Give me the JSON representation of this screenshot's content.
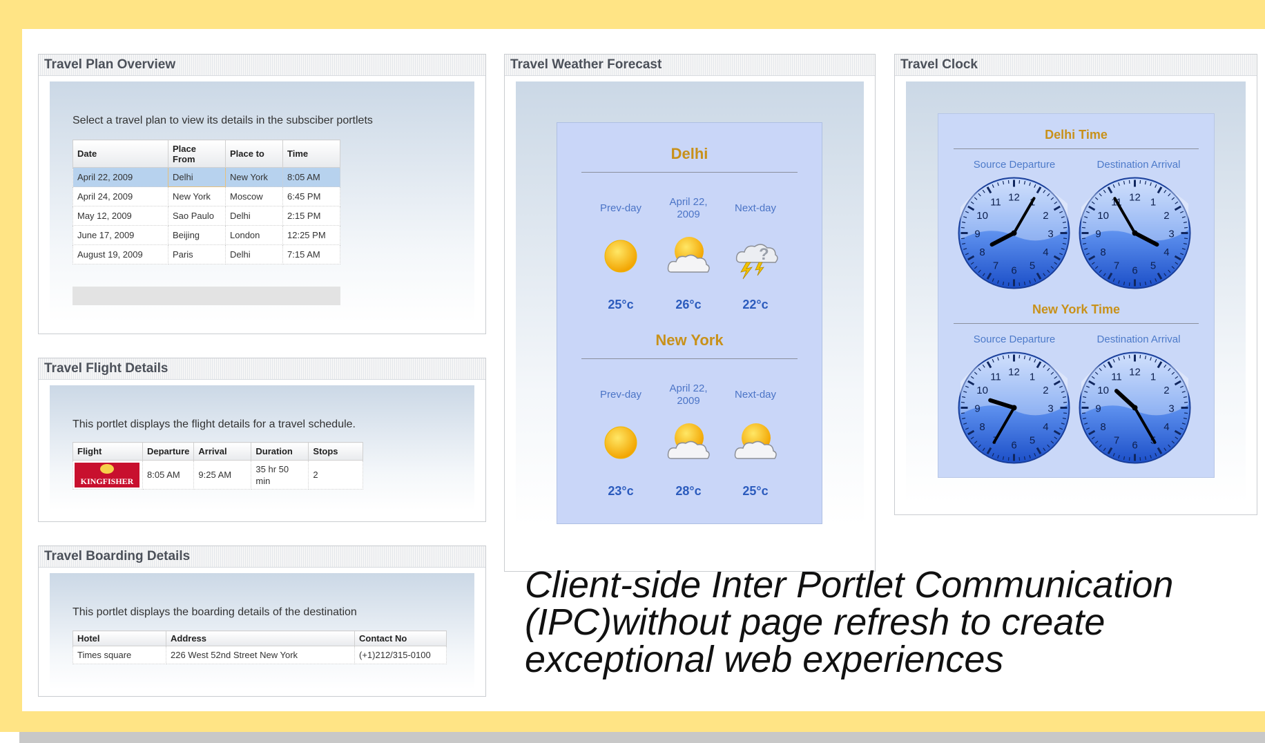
{
  "plan": {
    "title": "Travel Plan Overview",
    "intro": "Select a travel plan to view its details in the subsciber portlets",
    "columns": [
      "Date",
      "Place From",
      "Place to",
      "Time"
    ],
    "rows": [
      {
        "date": "April 22, 2009",
        "from": "Delhi",
        "to": "New York",
        "time": "8:05 AM"
      },
      {
        "date": "April 24, 2009",
        "from": "New York",
        "to": "Moscow",
        "time": "6:45 PM"
      },
      {
        "date": "May 12, 2009",
        "from": "Sao Paulo",
        "to": "Delhi",
        "time": "2:15 PM"
      },
      {
        "date": "June 17, 2009",
        "from": "Beijing",
        "to": "London",
        "time": "12:25 PM"
      },
      {
        "date": "August 19, 2009",
        "from": "Paris",
        "to": "Delhi",
        "time": "7:15 AM"
      }
    ],
    "selected_row": 0
  },
  "flight": {
    "title": "Travel Flight Details",
    "intro": "This portlet displays the flight details for a travel schedule.",
    "columns": [
      "Flight",
      "Departure",
      "Arrival",
      "Duration",
      "Stops"
    ],
    "row": {
      "logo_text": "KINGFISHER",
      "departure": "8:05 AM",
      "arrival": "9:25 AM",
      "duration": "35 hr 50 min",
      "stops": "2"
    }
  },
  "boarding": {
    "title": "Travel Boarding Details",
    "intro": "This portlet displays the boarding details of the destination",
    "columns": [
      "Hotel",
      "Address",
      "Contact No"
    ],
    "row": {
      "hotel": "Times square",
      "address": "226 West 52nd Street New York",
      "contact": "(+1)212/315-0100"
    }
  },
  "weather": {
    "title": "Travel Weather Forecast",
    "cities": [
      {
        "name": "Delhi",
        "days": [
          {
            "label": "Prev-day",
            "icon": "sun-icon",
            "temp": "25°c"
          },
          {
            "label": "April 22, 2009",
            "icon": "partly-cloudy-icon",
            "temp": "26°c"
          },
          {
            "label": "Next-day",
            "icon": "thunderstorm-icon",
            "temp": "22°c"
          }
        ]
      },
      {
        "name": "New York",
        "days": [
          {
            "label": "Prev-day",
            "icon": "sun-icon",
            "temp": "23°c"
          },
          {
            "label": "April 22, 2009",
            "icon": "partly-cloudy-icon",
            "temp": "28°c"
          },
          {
            "label": "Next-day",
            "icon": "partly-cloudy-icon",
            "temp": "25°c"
          }
        ]
      }
    ]
  },
  "clock": {
    "title": "Travel Clock",
    "groups": [
      {
        "name": "Delhi Time",
        "labels": [
          "Source Departure",
          "Destination Arrival"
        ],
        "times": [
          {
            "h": 8,
            "m": 5
          },
          {
            "h": 3,
            "m": 55
          }
        ]
      },
      {
        "name": "New York Time",
        "labels": [
          "Source Departure",
          "Destination Arrival"
        ],
        "times": [
          {
            "h": 9,
            "m": 35
          },
          {
            "h": 10,
            "m": 25
          }
        ]
      }
    ],
    "numerals": [
      "12",
      "1",
      "2",
      "3",
      "4",
      "5",
      "6",
      "7",
      "8",
      "9",
      "10",
      "11"
    ]
  },
  "tagline": "Client-side Inter Portlet Communication (IPC)without page refresh to create exceptional web experiences",
  "colors": {
    "frame": "#ffe485",
    "city_title": "#c8911a",
    "clock_face": "#2f6fe0",
    "selected_row": "#b7d2ee"
  }
}
